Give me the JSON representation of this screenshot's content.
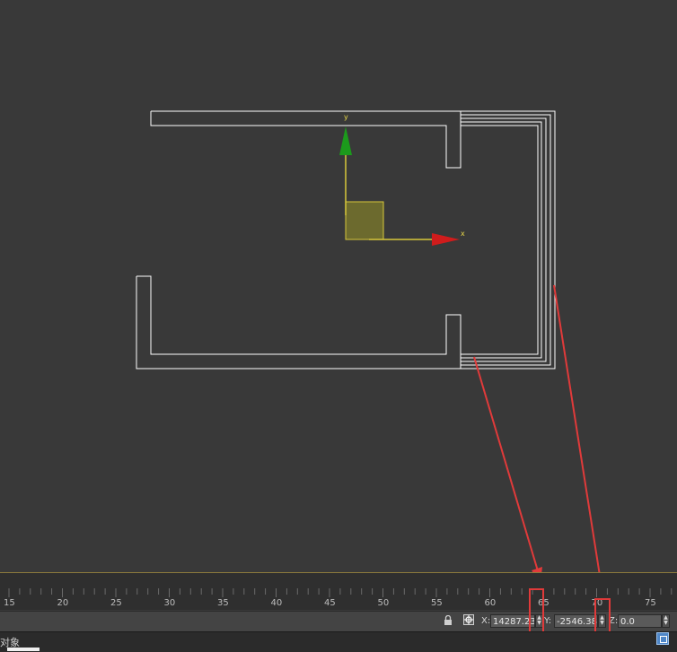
{
  "viewport": {
    "gizmo": {
      "x_axis_label": "x",
      "y_axis_label": "y"
    }
  },
  "timeline": {
    "ticks": [
      "15",
      "20",
      "25",
      "30",
      "35",
      "40",
      "45",
      "50",
      "55",
      "60",
      "65",
      "70",
      "75"
    ]
  },
  "coordinates": {
    "x_label": "X:",
    "x_value": "14287.231",
    "y_label": "Y:",
    "y_value": "-2546.385",
    "z_label": "Z:",
    "z_value": "0.0"
  },
  "prompt": {
    "text": "对象"
  },
  "colors": {
    "annotation": "#e03a3a",
    "gizmo_x": "#d01c1c",
    "gizmo_y": "#1c9a1c",
    "gizmo_plane": "#d8c83a",
    "wire": "#ffffff"
  },
  "icons": {
    "lock": "lock-icon",
    "absolute_mode": "absolute-mode-icon",
    "grid": "grid-icon"
  }
}
